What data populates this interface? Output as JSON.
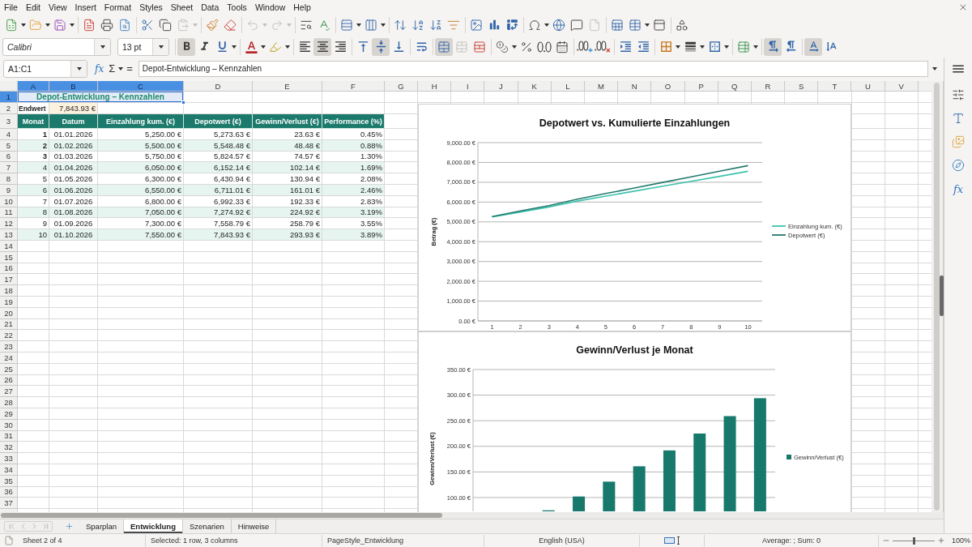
{
  "menu": [
    "File",
    "Edit",
    "View",
    "Insert",
    "Format",
    "Styles",
    "Sheet",
    "Data",
    "Tools",
    "Window",
    "Help"
  ],
  "standard_toolbar": {
    "paste": {
      "disabled": true
    },
    "undo": {
      "disabled": true
    },
    "redo": {
      "disabled": true
    },
    "headers_footers": {
      "disabled": true
    }
  },
  "formatting_toolbar": {
    "font_name": "Calibri",
    "font_size": "13 pt",
    "bold": {
      "on": true
    },
    "italic": {
      "on": false
    },
    "underline": {
      "on": false
    },
    "align_left": {
      "on": false
    },
    "align_center": {
      "on": true
    },
    "align_right": {
      "on": false
    },
    "align_top": {
      "on": false
    },
    "align_middle": {
      "on": true
    },
    "align_bottom": {
      "on": false
    },
    "merge_and_center": {
      "on": true
    },
    "merge_cells": {
      "disabled": true
    },
    "left_to_right": {
      "on": true
    },
    "right_to_left": {
      "on": false
    },
    "horizontal_text": {
      "on": true
    },
    "vertical_text": {
      "on": false
    }
  },
  "formula_bar": {
    "name_box": "A1:C1",
    "function_wizard": "fx",
    "sum": "Σ",
    "equals": "=",
    "formula": "Depot-Entwicklung – Kennzahlen"
  },
  "sidebar": {
    "functions_button": "fx"
  },
  "sheet": {
    "column_headers": [
      {
        "label": "A",
        "selected": true
      },
      {
        "label": "B",
        "selected": true
      },
      {
        "label": "C",
        "selected": true
      },
      {
        "label": "D",
        "selected": false
      },
      {
        "label": "E",
        "selected": false
      },
      {
        "label": "F",
        "selected": false
      },
      {
        "label": "G",
        "selected": false
      },
      {
        "label": "H",
        "selected": false
      },
      {
        "label": "I",
        "selected": false
      },
      {
        "label": "J",
        "selected": false
      },
      {
        "label": "K",
        "selected": false
      },
      {
        "label": "L",
        "selected": false
      },
      {
        "label": "M",
        "selected": false
      },
      {
        "label": "N",
        "selected": false
      },
      {
        "label": "O",
        "selected": false
      },
      {
        "label": "P",
        "selected": false
      },
      {
        "label": "Q",
        "selected": false
      },
      {
        "label": "R",
        "selected": false
      },
      {
        "label": "S",
        "selected": false
      },
      {
        "label": "T",
        "selected": false
      },
      {
        "label": "U",
        "selected": false
      },
      {
        "label": "V",
        "selected": false
      }
    ],
    "row_headers": [
      {
        "label": "1",
        "selected": true
      },
      {
        "label": "2",
        "selected": false
      },
      {
        "label": "3",
        "selected": false
      },
      {
        "label": "4",
        "selected": false
      },
      {
        "label": "5",
        "selected": false
      },
      {
        "label": "6",
        "selected": false
      },
      {
        "label": "7",
        "selected": false
      },
      {
        "label": "8",
        "selected": false
      },
      {
        "label": "9",
        "selected": false
      },
      {
        "label": "10",
        "selected": false
      },
      {
        "label": "11",
        "selected": false
      },
      {
        "label": "12",
        "selected": false
      },
      {
        "label": "13",
        "selected": false
      },
      {
        "label": "14",
        "selected": false
      },
      {
        "label": "15",
        "selected": false
      },
      {
        "label": "16",
        "selected": false
      },
      {
        "label": "17",
        "selected": false
      },
      {
        "label": "18",
        "selected": false
      },
      {
        "label": "19",
        "selected": false
      },
      {
        "label": "20",
        "selected": false
      },
      {
        "label": "21",
        "selected": false
      },
      {
        "label": "22",
        "selected": false
      },
      {
        "label": "23",
        "selected": false
      },
      {
        "label": "24",
        "selected": false
      },
      {
        "label": "25",
        "selected": false
      },
      {
        "label": "26",
        "selected": false
      },
      {
        "label": "27",
        "selected": false
      },
      {
        "label": "28",
        "selected": false
      },
      {
        "label": "29",
        "selected": false
      },
      {
        "label": "30",
        "selected": false
      },
      {
        "label": "31",
        "selected": false
      },
      {
        "label": "32",
        "selected": false
      },
      {
        "label": "33",
        "selected": false
      },
      {
        "label": "34",
        "selected": false
      },
      {
        "label": "35",
        "selected": false
      },
      {
        "label": "36",
        "selected": false
      },
      {
        "label": "37",
        "selected": false
      }
    ],
    "title": {
      "text": "Depot-Entwicklung – Kennzahlen",
      "selected": true
    },
    "summary": {
      "label": "Endwert",
      "value": "7,843.93 €"
    },
    "table": {
      "columns": [
        "Monat",
        "Datum",
        "Einzahlung kum. (€)",
        "Depotwert (€)",
        "Gewinn/Verlust (€)",
        "Performance (%)"
      ],
      "rows": [
        {
          "cells": [
            "1",
            "01.01.2026",
            "5,250.00 €",
            "5,273.63 €",
            "23.63 €",
            "0.45%"
          ],
          "shaded": false,
          "month_bold": true
        },
        {
          "cells": [
            "2",
            "01.02.2026",
            "5,500.00 €",
            "5,548.48 €",
            "48.48 €",
            "0.88%"
          ],
          "shaded": true,
          "month_bold": true
        },
        {
          "cells": [
            "3",
            "01.03.2026",
            "5,750.00 €",
            "5,824.57 €",
            "74.57 €",
            "1.30%"
          ],
          "shaded": false,
          "month_bold": true
        },
        {
          "cells": [
            "4",
            "01.04.2026",
            "6,050.00 €",
            "6,152.14 €",
            "102.14 €",
            "1.69%"
          ],
          "shaded": true,
          "month_bold": false
        },
        {
          "cells": [
            "5",
            "01.05.2026",
            "6,300.00 €",
            "6,430.94 €",
            "130.94 €",
            "2.08%"
          ],
          "shaded": false,
          "month_bold": false
        },
        {
          "cells": [
            "6",
            "01.06.2026",
            "6,550.00 €",
            "6,711.01 €",
            "161.01 €",
            "2.46%"
          ],
          "shaded": true,
          "month_bold": false
        },
        {
          "cells": [
            "7",
            "01.07.2026",
            "6,800.00 €",
            "6,992.33 €",
            "192.33 €",
            "2.83%"
          ],
          "shaded": false,
          "month_bold": false
        },
        {
          "cells": [
            "8",
            "01.08.2026",
            "7,050.00 €",
            "7,274.92 €",
            "224.92 €",
            "3.19%"
          ],
          "shaded": true,
          "month_bold": false
        },
        {
          "cells": [
            "9",
            "01.09.2026",
            "7,300.00 €",
            "7,558.79 €",
            "258.79 €",
            "3.55%"
          ],
          "shaded": false,
          "month_bold": false
        },
        {
          "cells": [
            "10",
            "01.10.2026",
            "7,550.00 €",
            "7,843.93 €",
            "293.93 €",
            "3.89%"
          ],
          "shaded": true,
          "month_bold": false
        }
      ]
    }
  },
  "charts": [
    {
      "chart_data": {
        "type": "line",
        "title": "Depotwert vs. Kumulierte Einzahlungen",
        "ylabel": "Betrag (€)",
        "categories": [
          "1",
          "2",
          "3",
          "4",
          "5",
          "6",
          "7",
          "8",
          "9",
          "10"
        ],
        "series": [
          {
            "name": "Einzahlung kum. (€)",
            "color": "#3cc2ad",
            "values": [
              5250,
              5500,
              5750,
              6050,
              6300,
              6550,
              6800,
              7050,
              7300,
              7550
            ]
          },
          {
            "name": "Depotwert (€)",
            "color": "#237a6e",
            "values": [
              5270,
              5550,
              5820,
              6150,
              6430,
              6710,
              6990,
              7270,
              7560,
              7840
            ]
          }
        ],
        "ylim": [
          0,
          9000
        ],
        "yticks": [
          {
            "value": 0,
            "label": "0.00 €"
          },
          {
            "value": 1000,
            "label": "1,000.00 €"
          },
          {
            "value": 2000,
            "label": "2,000.00 €"
          },
          {
            "value": 3000,
            "label": "3,000.00 €"
          },
          {
            "value": 4000,
            "label": "4,000.00 €"
          },
          {
            "value": 5000,
            "label": "5,000.00 €"
          },
          {
            "value": 6000,
            "label": "6,000.00 €"
          },
          {
            "value": 7000,
            "label": "7,000.00 €"
          },
          {
            "value": 8000,
            "label": "8,000.00 €"
          },
          {
            "value": 9000,
            "label": "9,000.00 €"
          }
        ],
        "grid": true,
        "legend": "right"
      }
    },
    {
      "chart_data": {
        "type": "bar",
        "title": "Gewinn/Verlust je Monat",
        "ylabel": "Gewinn/Verlust (€)",
        "series": [
          {
            "name": "Gewinn/Verlust (€)",
            "color": "#17786c",
            "values": [
              null,
              null,
              75,
              102,
              131,
              161,
              192,
              225,
              259,
              294
            ]
          }
        ],
        "ylim": [
          73,
          350
        ],
        "yticks": [
          {
            "value": 100,
            "label": "100.00 €"
          },
          {
            "value": 150,
            "label": "150.00 €"
          },
          {
            "value": 200,
            "label": "200.00 €"
          },
          {
            "value": 250,
            "label": "250.00 €"
          },
          {
            "value": 300,
            "label": "300.00 €"
          },
          {
            "value": 350,
            "label": "350.00 €"
          }
        ],
        "grid": true,
        "legend": "right"
      }
    }
  ],
  "sheet_tabs": [
    {
      "label": "Sparplan",
      "selected": false
    },
    {
      "label": "Entwicklung",
      "selected": true
    },
    {
      "label": "Szenarien",
      "selected": false
    },
    {
      "label": "Hinweise",
      "selected": false
    }
  ],
  "status_bar": {
    "sheet": "Sheet 2 of 4",
    "selection": "Selected: 1 row, 3 columns",
    "page_style": "PageStyle_Entwicklung",
    "language": "English (USA)",
    "summary": "Average: ; Sum: 0",
    "zoom": {
      "level": 0.5,
      "reading": "100%"
    }
  }
}
